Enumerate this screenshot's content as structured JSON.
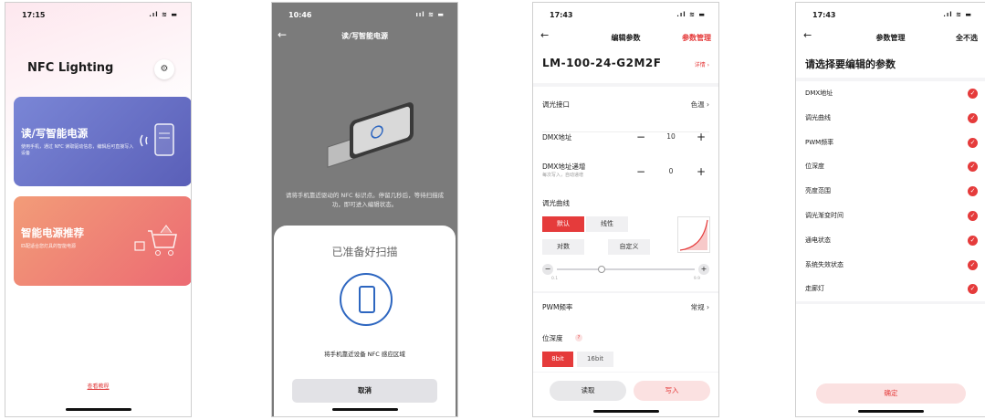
{
  "colors": {
    "accent": "#e53b3b",
    "card_rw": "#5a5fb8",
    "card_rec": "#ec6a73"
  },
  "screen1": {
    "time": "17:15",
    "status_icons": ".ıl ≋ ▬",
    "app_title": "NFC Lighting",
    "settings_icon": "gear-icon",
    "card_rw": {
      "title": "读/写智能电源",
      "desc": "使用手机，通过 NFC 读取驱动信息，编辑后可直接写入设备"
    },
    "card_rec": {
      "title": "智能电源推荐",
      "desc": "匹配适合您灯具的智能电源"
    },
    "tutorial": "查看教程"
  },
  "screen2": {
    "time": "10:46",
    "status_icons": "ııl ≋ ▬",
    "title": "读/写智能电源",
    "hint": "请将手机靠近驱动的 NFC 标识点。停留几秒后，等待扫描成功，即可进入编辑状态。",
    "sheet_title": "已准备好扫描",
    "sheet_message": "将手机靠近设备 NFC 感应区域",
    "cancel": "取消"
  },
  "screen3": {
    "time": "17:43",
    "status_icons": ".ıl ≋ ▬",
    "title": "编辑参数",
    "manage": "参数管理",
    "model": "LM-100-24-G2M2F",
    "details": "详情 ›",
    "dim_interface": {
      "label": "调光接口",
      "value": "色温 ›"
    },
    "dmx_address": {
      "label": "DMX地址",
      "minus": "−",
      "value": "10",
      "plus": "+"
    },
    "dmx_increment": {
      "label": "DMX地址递增",
      "sub": "每次写入，自动递增",
      "minus": "−",
      "value": "0",
      "plus": "+"
    },
    "curve": {
      "label": "调光曲线",
      "options": [
        "默认",
        "线性",
        "对数",
        "自定义"
      ],
      "selected": "默认",
      "slider_min": "0.1",
      "slider_max": "9.9",
      "slider_value": 0.3,
      "minus": "−",
      "plus": "+"
    },
    "pwm": {
      "label": "PWM频率",
      "value": "常规 ›"
    },
    "bit_depth": {
      "label": "位深度",
      "help": "?",
      "options": [
        "8bit",
        "16bit"
      ],
      "selected": "8bit"
    },
    "read": "读取",
    "write": "写入"
  },
  "screen4": {
    "time": "17:43",
    "status_icons": ".ıl ≋ ▬",
    "title": "参数管理",
    "deselect_all": "全不选",
    "heading": "请选择要编辑的参数",
    "items": [
      "DMX地址",
      "调光曲线",
      "PWM频率",
      "位深度",
      "亮度范围",
      "调光渐变时间",
      "通电状态",
      "系统失效状态",
      "走廊灯"
    ],
    "check": "✓",
    "confirm": "确定"
  }
}
